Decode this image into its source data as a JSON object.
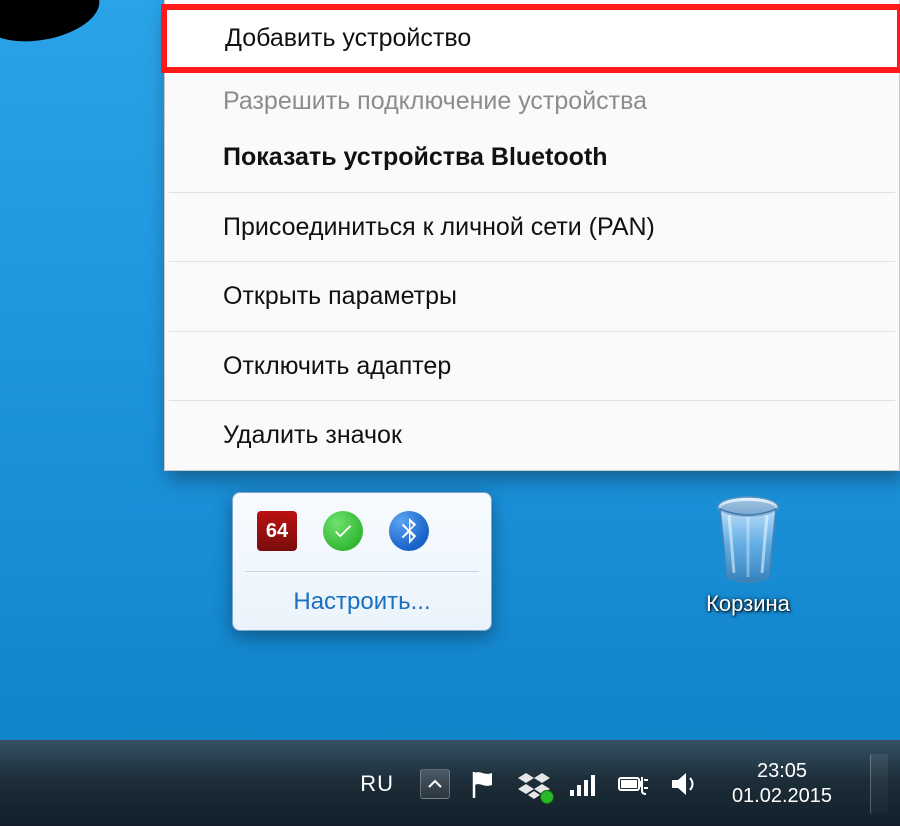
{
  "menu": {
    "items": [
      {
        "label": "Добавить устройство",
        "highlighted": true
      },
      {
        "label": "Разрешить подключение устройства",
        "disabled": true
      },
      {
        "label": "Показать устройства Bluetooth",
        "bold": true
      },
      {
        "sep": true
      },
      {
        "label": "Присоединиться к личной сети (PAN)"
      },
      {
        "sep": true
      },
      {
        "label": "Открыть параметры"
      },
      {
        "sep": true
      },
      {
        "label": "Отключить адаптер"
      },
      {
        "sep": true
      },
      {
        "label": "Удалить значок"
      }
    ]
  },
  "tray_popup": {
    "icons": {
      "aida": "64"
    },
    "link": "Настроить..."
  },
  "desktop": {
    "recycle_bin_label": "Корзина"
  },
  "taskbar": {
    "lang": "RU",
    "time": "23:05",
    "date": "01.02.2015"
  }
}
